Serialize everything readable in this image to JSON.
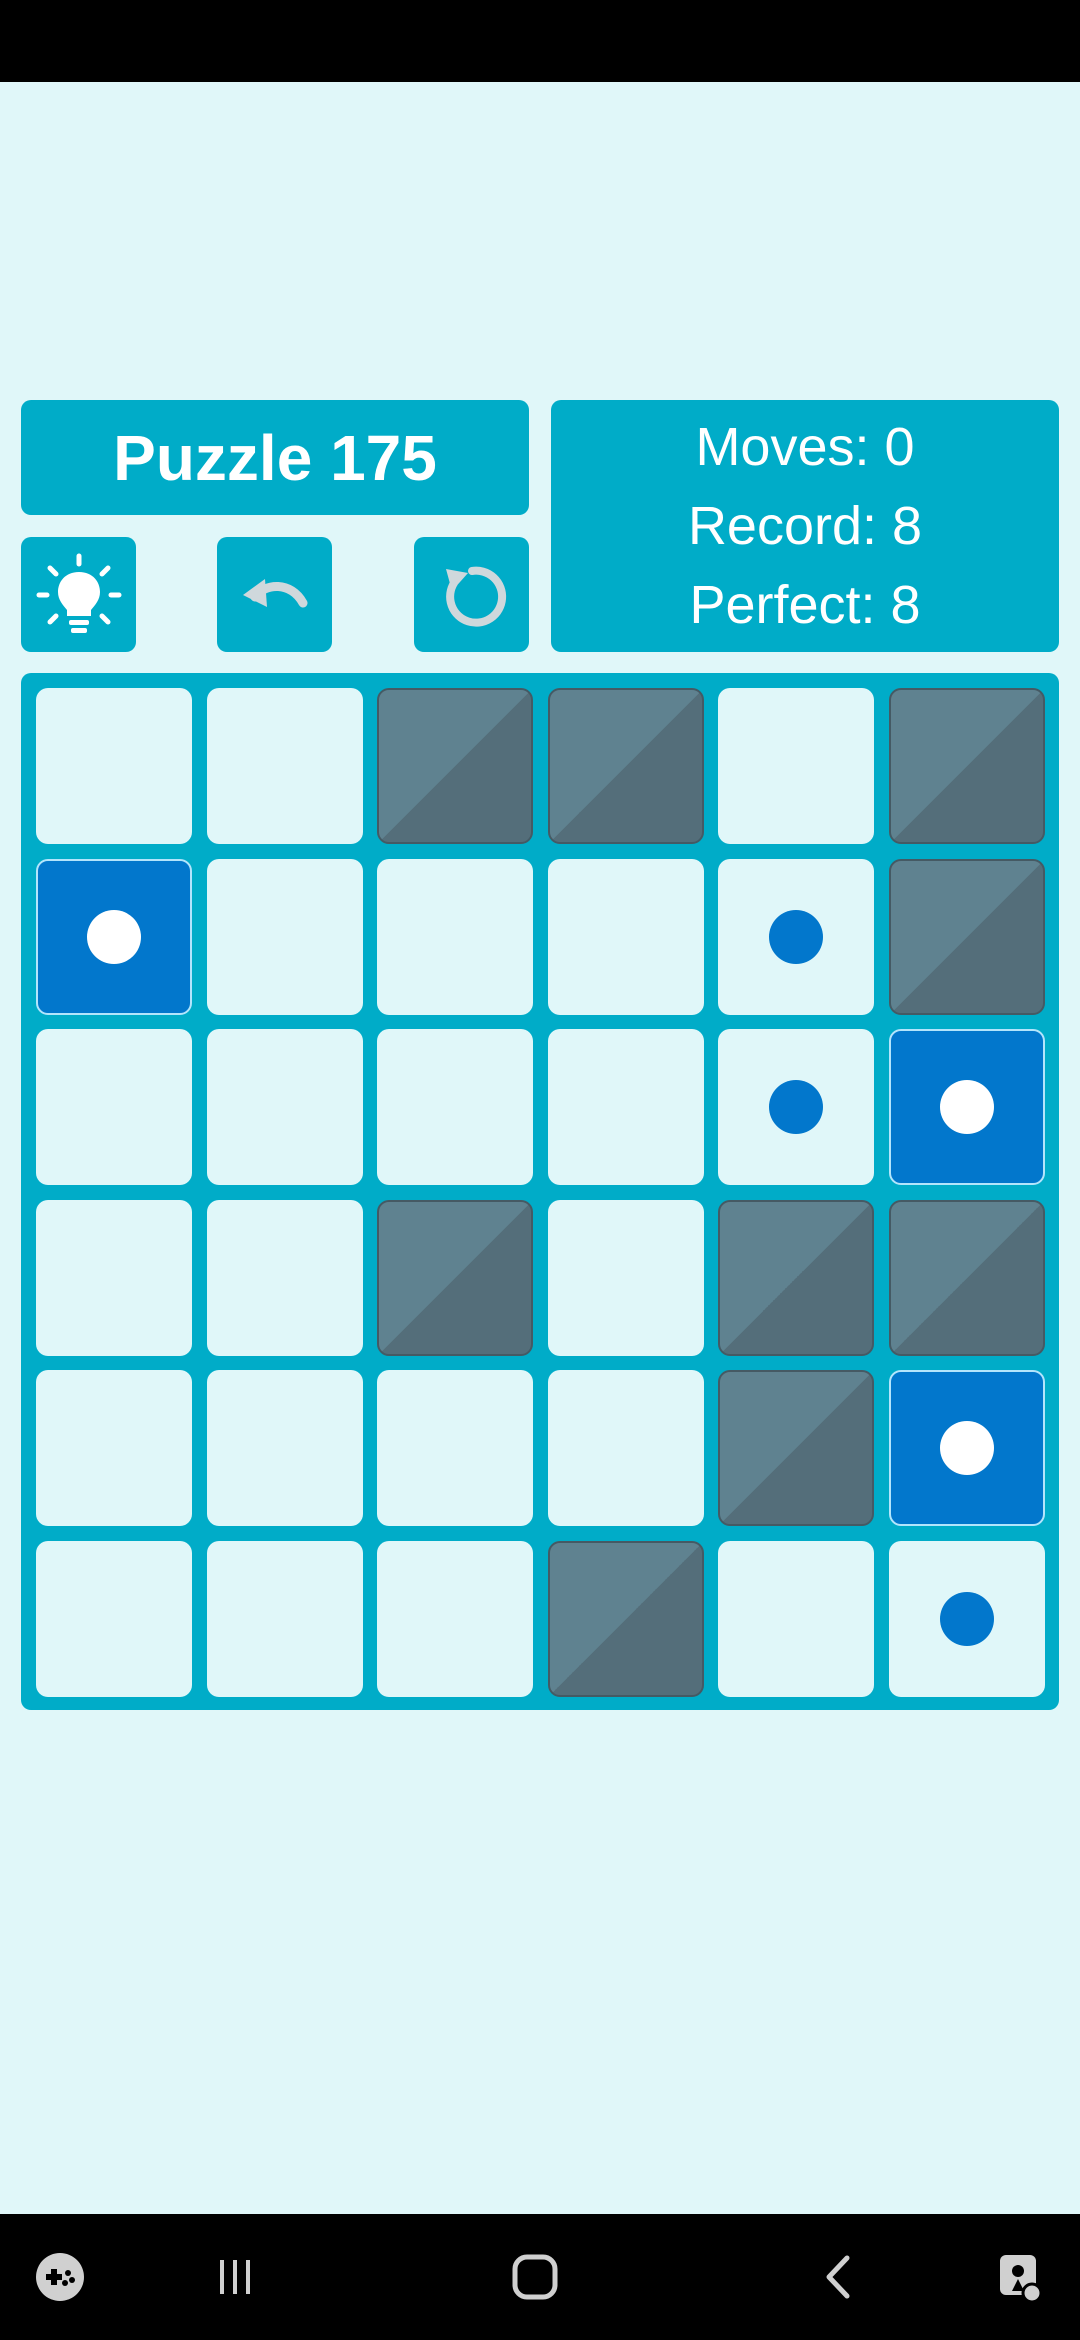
{
  "header": {
    "title": "Puzzle 175"
  },
  "stats": {
    "moves": "Moves: 0",
    "record": "Record: 8",
    "perfect": "Perfect: 8"
  },
  "toolbar": {
    "hint_icon": "lightbulb-icon",
    "undo_icon": "undo-icon",
    "restart_icon": "restart-icon"
  },
  "board": {
    "size": 6,
    "legend": {
      "E": "empty",
      "W": "wall",
      "D": "empty-with-blue-dot",
      "F": "filled-blue-with-white-dot"
    },
    "rows": [
      [
        "E",
        "E",
        "W",
        "W",
        "E",
        "W"
      ],
      [
        "F",
        "E",
        "E",
        "E",
        "D",
        "W"
      ],
      [
        "E",
        "E",
        "E",
        "E",
        "D",
        "F"
      ],
      [
        "E",
        "E",
        "W",
        "E",
        "W",
        "W"
      ],
      [
        "E",
        "E",
        "E",
        "E",
        "W",
        "F"
      ],
      [
        "E",
        "E",
        "E",
        "W",
        "E",
        "D"
      ]
    ]
  },
  "nav": {
    "icons": [
      "game-launcher-icon",
      "recent-apps-icon",
      "home-icon",
      "back-icon",
      "accessibility-icon"
    ]
  },
  "colors": {
    "background": "#e0f7f9",
    "accent": "#00acc8",
    "filled": "#0277cc",
    "wall": "#5f8290"
  }
}
